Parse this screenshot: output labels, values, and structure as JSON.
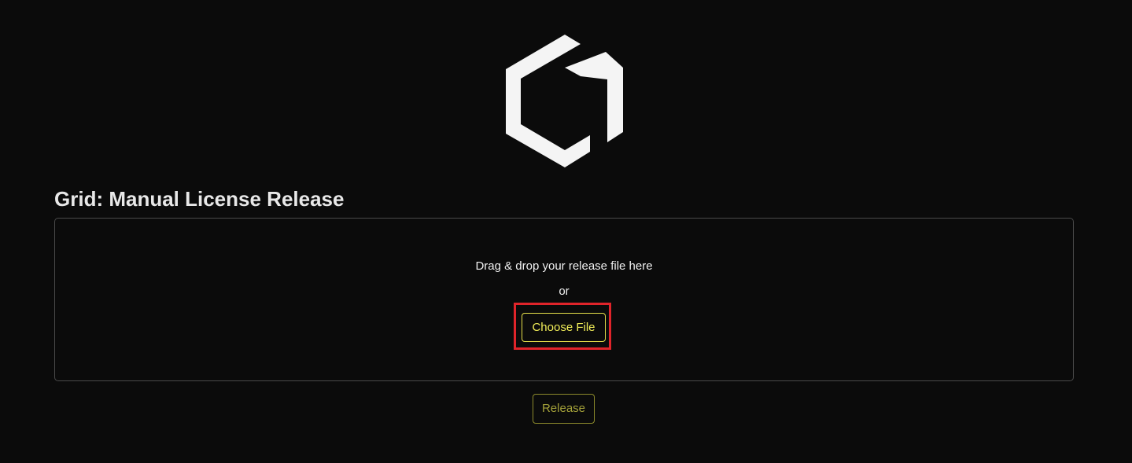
{
  "header": {
    "logo_icon": "hexagon-logo-icon"
  },
  "page": {
    "title": "Grid: Manual License Release"
  },
  "dropzone": {
    "instruction": "Drag & drop your release file here",
    "separator": "or",
    "choose_file_label": "Choose File"
  },
  "actions": {
    "release_label": "Release"
  },
  "colors": {
    "background": "#0b0b0b",
    "accent_yellow": "#f0ec58",
    "highlight_red": "#e0242a"
  }
}
